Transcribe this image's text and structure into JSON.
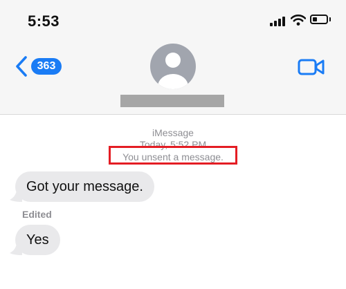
{
  "status_bar": {
    "time": "5:53"
  },
  "header": {
    "back_badge": "363",
    "icons": [
      "chevron-left-icon",
      "person-icon",
      "video-camera-icon"
    ],
    "accent_color": "#1a7cf5"
  },
  "thread": {
    "service": "iMessage",
    "timestamp": "Today, 5:52 PM",
    "unsent_notice": "You unsent a message.",
    "highlight_color": "#e41d24",
    "messages": [
      {
        "text": "Got your message."
      },
      {
        "edited_label": "Edited",
        "text": "Yes"
      }
    ]
  }
}
